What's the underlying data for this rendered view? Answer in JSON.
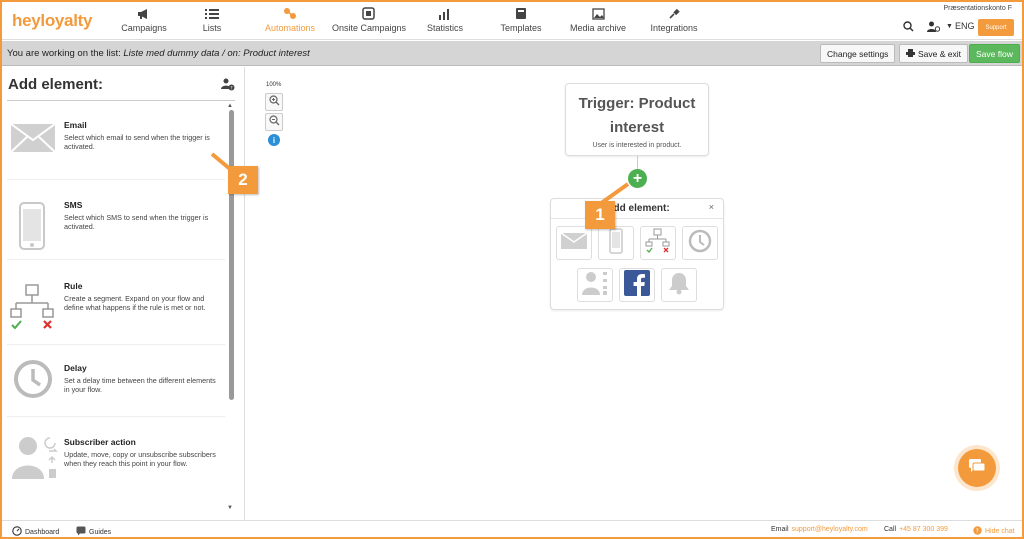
{
  "brand": {
    "logo_text": "heyloyalty",
    "accent": "#f39a3c",
    "green": "#5cb85c",
    "info_blue": "#2a8fd8"
  },
  "nav": [
    {
      "label": "Campaigns",
      "icon": "megaphone-icon"
    },
    {
      "label": "Lists",
      "icon": "list-icon"
    },
    {
      "label": "Automations",
      "icon": "automation-icon",
      "active": true
    },
    {
      "label": "Onsite Campaigns",
      "icon": "onsite-icon"
    },
    {
      "label": "Statistics",
      "icon": "statistics-icon"
    },
    {
      "label": "Templates",
      "icon": "template-icon"
    },
    {
      "label": "Media archive",
      "icon": "image-icon"
    },
    {
      "label": "Integrations",
      "icon": "plug-icon"
    }
  ],
  "account": {
    "name": "Præsentationskonto F",
    "language": "ENG",
    "support_label": "Support"
  },
  "workbar": {
    "prefix": "You are working on the list:",
    "list_name": "Liste med dummy data",
    "on_label": "/ on:",
    "flow_name": "Product interest",
    "change_settings": "Change settings",
    "save_exit": "Save & exit",
    "save_flow": "Save flow"
  },
  "sidebar": {
    "title": "Add element:",
    "items": [
      {
        "name": "Email",
        "desc": "Select which email to send when the trigger is activated.",
        "icon": "email-icon"
      },
      {
        "name": "SMS",
        "desc": "Select which SMS to send when the trigger is activated.",
        "icon": "phone-icon"
      },
      {
        "name": "Rule",
        "desc": "Create a segment. Expand on your flow and define what happens if the rule is met or not.",
        "icon": "rule-icon"
      },
      {
        "name": "Delay",
        "desc": "Set a delay time between the different elements in your flow.",
        "icon": "clock-icon"
      },
      {
        "name": "Subscriber action",
        "desc": "Update, move, copy or unsubscribe subscribers when they reach this point in your flow.",
        "icon": "subscriber-action-icon"
      }
    ]
  },
  "canvas": {
    "zoom_level": "100%",
    "trigger_title": "Trigger: Product interest",
    "trigger_desc": "User is interested in product.",
    "popup_title": "Add element:",
    "popup_close": "×",
    "badge_1": "1",
    "badge_2": "2"
  },
  "footer": {
    "dashboard": "Dashboard",
    "guides": "Guides",
    "email_label": "Email",
    "email": "support@heyloyalty.com",
    "call_label": "Call",
    "phone": "+45 87 300 399",
    "hide_chat": "Hide chat"
  }
}
